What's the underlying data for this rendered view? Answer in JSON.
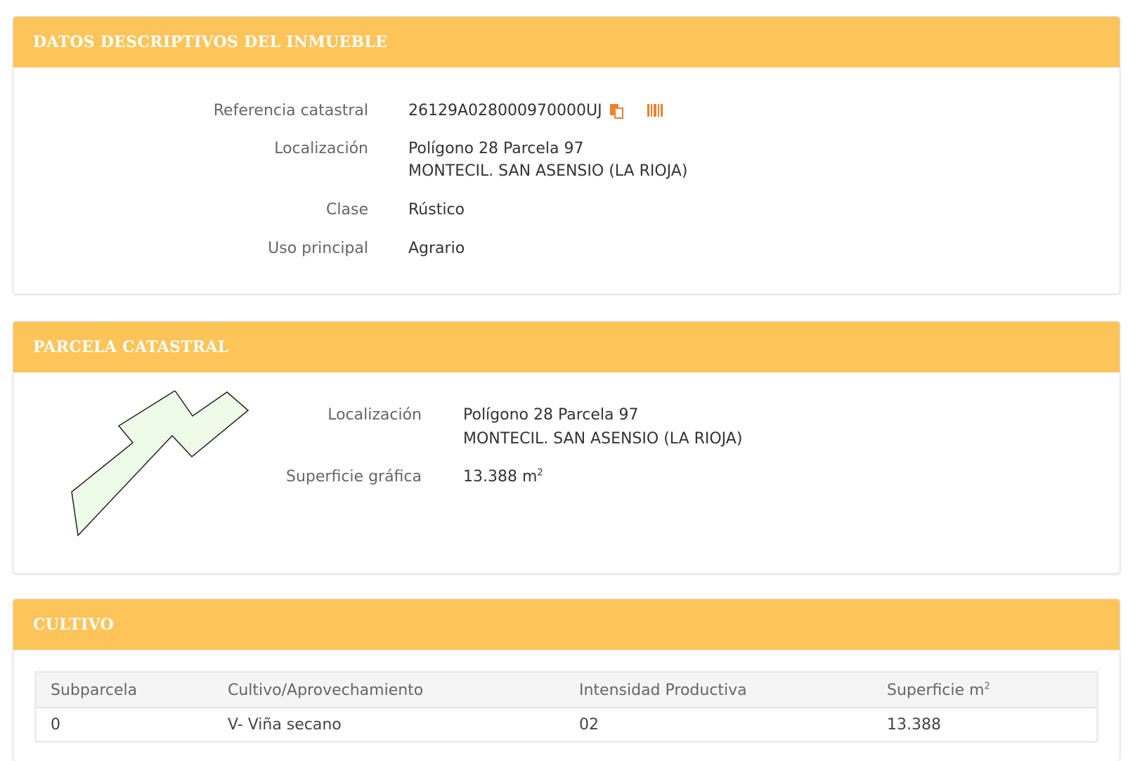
{
  "inmueble": {
    "title": "DATOS DESCRIPTIVOS DEL INMUEBLE",
    "ref_label": "Referencia catastral",
    "ref_value": "26129A028000970000UJ",
    "loc_label": "Localización",
    "loc_line1": "Polígono 28 Parcela 97",
    "loc_line2": "MONTECIL. SAN ASENSIO (LA RIOJA)",
    "clase_label": "Clase",
    "clase_value": "Rústico",
    "uso_label": "Uso principal",
    "uso_value": "Agrario",
    "icons": [
      "copy-icon",
      "barcode-icon"
    ]
  },
  "parcela": {
    "title": "PARCELA CATASTRAL",
    "loc_label": "Localización",
    "loc_line1": "Polígono 28 Parcela 97",
    "loc_line2": "MONTECIL. SAN ASENSIO (LA RIOJA)",
    "sup_label": "Superficie gráfica",
    "sup_value": "13.388 m",
    "sup_exp": "2"
  },
  "cultivo": {
    "title": "CULTIVO",
    "columns": [
      "Subparcela",
      "Cultivo/Aprovechamiento",
      "Intensidad Productiva",
      "Superficie m"
    ],
    "col_exp": "2",
    "rows": [
      [
        "0",
        "V- Viña secano",
        "02",
        "13.388"
      ]
    ]
  },
  "colors": {
    "header_bg": "#fdc45a",
    "icon_orange": "#f07f2a",
    "parcel_fill": "#eefbe9"
  }
}
